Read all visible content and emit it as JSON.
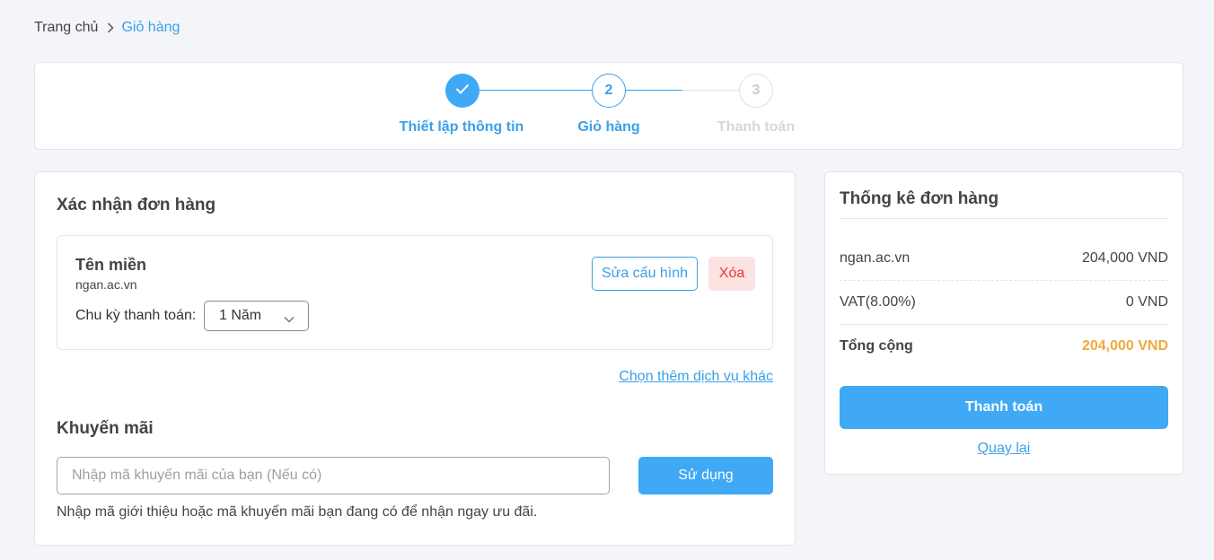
{
  "breadcrumb": {
    "home": "Trang chủ",
    "current": "Giỏ hàng"
  },
  "stepper": {
    "steps": [
      {
        "number": "1",
        "label": "Thiết lập thông tin",
        "state": "completed"
      },
      {
        "number": "2",
        "label": "Giỏ hàng",
        "state": "active"
      },
      {
        "number": "3",
        "label": "Thanh toán",
        "state": "pending"
      }
    ]
  },
  "order": {
    "title": "Xác nhận đơn hàng",
    "item": {
      "name": "Tên miền",
      "domain": "ngan.ac.vn",
      "cycle_label": "Chu kỳ thanh toán:",
      "cycle_value": "1 Năm",
      "edit_label": "Sửa cấu hình",
      "delete_label": "Xóa"
    },
    "more_services_link": "Chọn thêm dịch vụ khác"
  },
  "promo": {
    "title": "Khuyến mãi",
    "placeholder": "Nhập mã khuyến mãi của bạn (Nếu có)",
    "value": "",
    "use_label": "Sử dụng",
    "help": "Nhập mã giới thiệu hoặc mã khuyến mãi bạn đang có để nhận ngay ưu đãi."
  },
  "summary": {
    "title": "Thống kê đơn hàng",
    "rows": [
      {
        "label": "ngan.ac.vn",
        "value": "204,000 VND"
      },
      {
        "label": "VAT(8.00%)",
        "value": "0 VND"
      }
    ],
    "total_label": "Tổng cộng",
    "total_value": "204,000 VND",
    "pay_label": "Thanh toán",
    "back_label": "Quay lại"
  },
  "colors": {
    "accent": "#3fa9f5",
    "link": "#3aa0e8",
    "total": "#f0a93b",
    "danger": "#e53935",
    "danger_bg": "#fde2e2",
    "pending": "#c8cdd2"
  },
  "icons": {
    "breadcrumb_separator": "chevron-right-icon",
    "step_completed": "check-icon",
    "select_caret": "chevron-down-icon"
  }
}
